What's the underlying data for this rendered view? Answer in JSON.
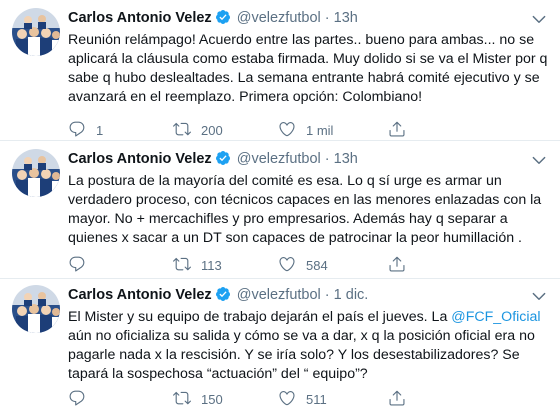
{
  "tweets": [
    {
      "name": "Carlos Antonio Velez",
      "handle": "@velezfutbol",
      "separator": "·",
      "time": "13h",
      "text_before": "Reunión relámpago! Acuerdo entre las partes.. bueno para ambas... no se aplicará la cláusula como estaba firmada. Muy dolido si se va el Mister por q sabe q hubo deslealtades. La semana entrante habrá comité ejecutivo y se avanzará en el reemplazo. Primera opción: Colombiano!",
      "replies": "1",
      "retweets": "200",
      "likes": "1 mil"
    },
    {
      "name": "Carlos Antonio Velez",
      "handle": "@velezfutbol",
      "separator": "·",
      "time": "13h",
      "text_before": "La postura de la mayoría del comité es esa. Lo q sí urge es armar un verdadero proceso, con técnicos capaces en las menores enlazadas con la mayor. No + mercachifles y pro empresarios. Además hay q separar a quienes x sacar a un DT son capaces de patrocinar la peor humillación .",
      "replies": "",
      "retweets": "113",
      "likes": "584"
    },
    {
      "name": "Carlos Antonio Velez",
      "handle": "@velezfutbol",
      "separator": "·",
      "time": "1 dic.",
      "text_before": "El Mister y su equipo de trabajo dejarán el país el jueves. La ",
      "mention": "@FCF_Oficial",
      "text_after": " aún no oficializa su salida y cómo se va a dar, x q la posición oficial era no pagarle nada x la rescisión. Y se iría solo? Y los desestabilizadores? Se tapará la sospechosa “actuación” del “ equipo”?",
      "replies": "",
      "retweets": "150",
      "likes": "511"
    }
  ],
  "icons": {
    "avatar": "avatar-image",
    "verified": "verified-badge-icon",
    "caret": "chevron-down-icon",
    "reply": "reply-icon",
    "retweet": "retweet-icon",
    "like": "heart-icon",
    "share": "share-icon"
  },
  "colors": {
    "text": "#0f1419",
    "secondary": "#5b7083",
    "accent": "#1b95e0",
    "divider": "#e6ecf0",
    "verified": "#1da1f2"
  }
}
